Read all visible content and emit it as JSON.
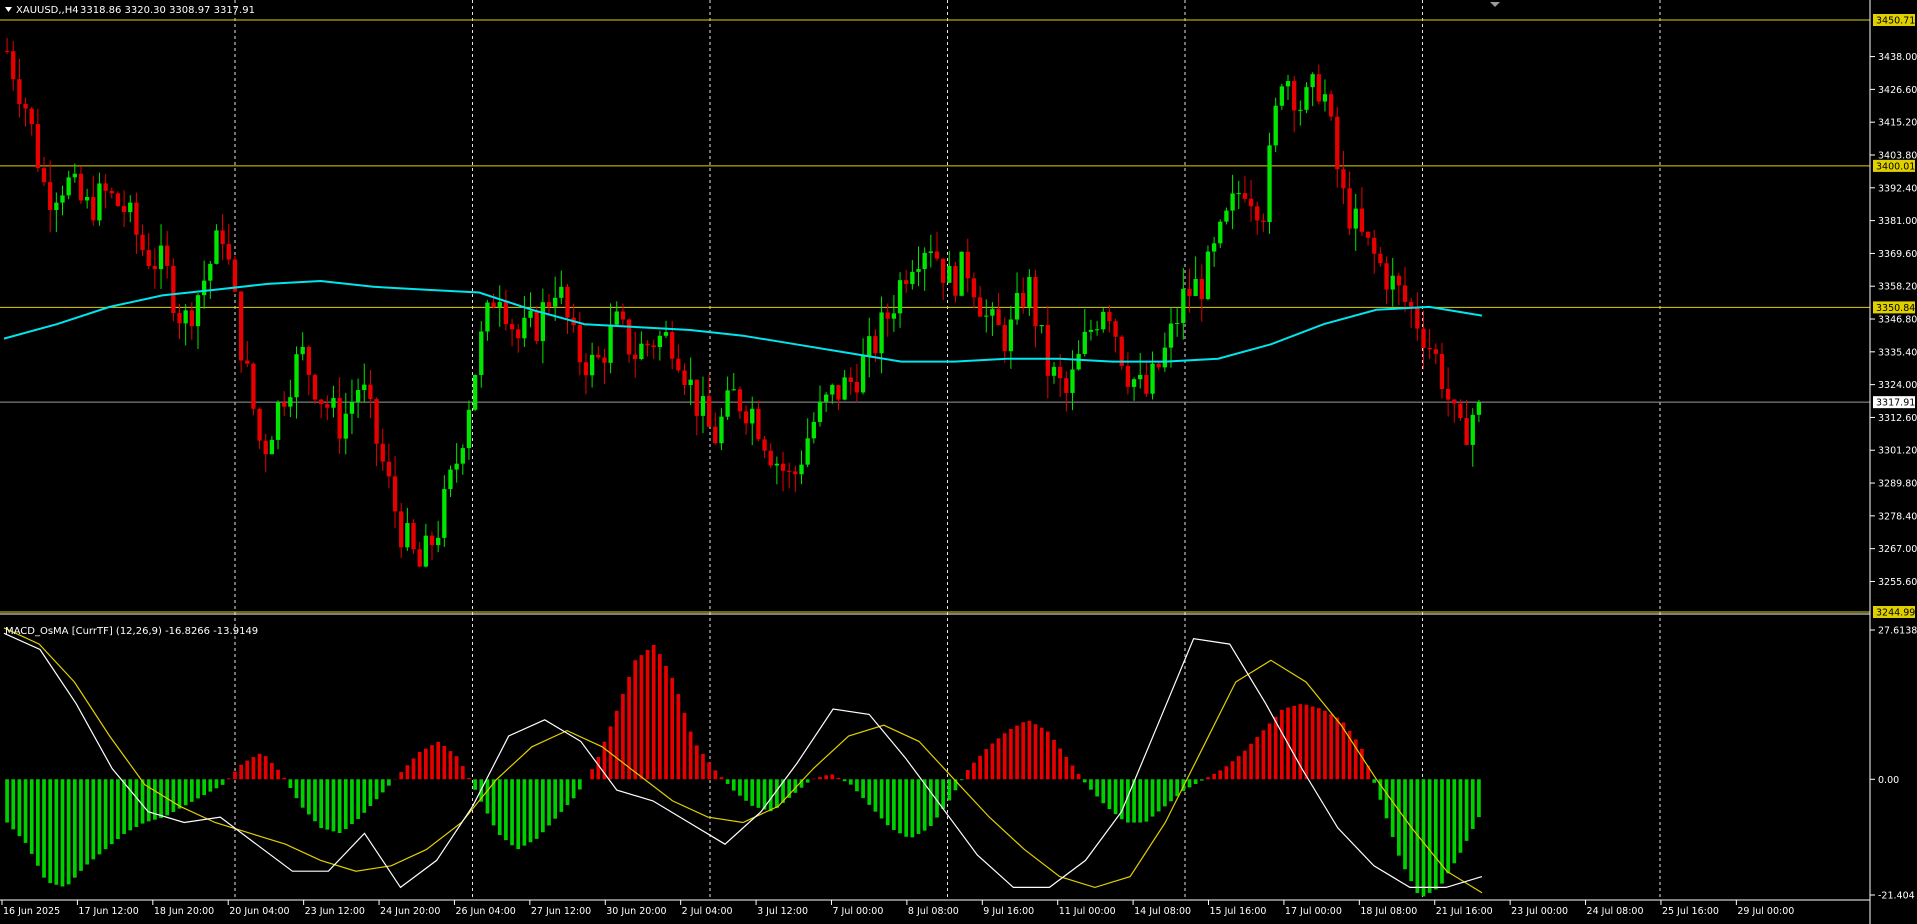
{
  "header": {
    "symbol_label": "XAUUSD,,H4",
    "ohlc_label": "3318.86 3320.30 3308.97 3317.91"
  },
  "indicator": {
    "label": "MACD_OsMA [CurrTF] (12,26,9) -16.8266 -13.9149"
  },
  "colors": {
    "background": "#000000",
    "bull_candle": "#00e600",
    "bear_candle": "#e60000",
    "moving_average": "#00e5ee",
    "hline": "#e0d000",
    "bid_line": "#9a9a9a",
    "macd_line": "#ffffff",
    "signal_line": "#e0d000",
    "osma_positive": "#e60000",
    "osma_negative": "#00d000",
    "grid": "#ffffff"
  },
  "chart_data": [
    {
      "type": "candlestick",
      "title": "",
      "ylim": [
        3244.99,
        3450.71
      ],
      "y_ticks": [
        "3438.00",
        "3426.60",
        "3415.20",
        "3403.80",
        "3392.40",
        "3381.00",
        "3369.60",
        "3358.20",
        "3346.80",
        "3335.40",
        "3324.00",
        "3312.60",
        "3301.20",
        "3289.80",
        "3278.40",
        "3267.00",
        "3255.60"
      ],
      "x_ticks": [
        "16 Jun 2025",
        "17 Jun 12:00",
        "18 Jun 20:00",
        "20 Jun 04:00",
        "23 Jun 12:00",
        "24 Jun 20:00",
        "26 Jun 04:00",
        "27 Jun 12:00",
        "30 Jun 20:00",
        "2 Jul 04:00",
        "3 Jul 12:00",
        "7 Jul 00:00",
        "8 Jul 08:00",
        "9 Jul 16:00",
        "11 Jul 00:00",
        "14 Jul 08:00",
        "15 Jul 16:00",
        "17 Jul 00:00",
        "18 Jul 08:00",
        "21 Jul 16:00",
        "23 Jul 00:00",
        "24 Jul 08:00",
        "25 Jul 16:00",
        "29 Jul 00:00"
      ],
      "horizontal_lines": [
        {
          "value": 3450.71,
          "label": "3450.71"
        },
        {
          "value": 3400.01,
          "label": "3400.01"
        },
        {
          "value": 3350.84,
          "label": "3350.84"
        },
        {
          "value": 3244.99,
          "label": "3244.99"
        }
      ],
      "bid": {
        "value": 3317.91,
        "label": "3317.91"
      },
      "path": [
        3440,
        3420,
        3390,
        3395,
        3385,
        3390,
        3385,
        3370,
        3365,
        3345,
        3360,
        3378,
        3335,
        3300,
        3320,
        3335,
        3320,
        3310,
        3325,
        3300,
        3275,
        3260,
        3275,
        3300,
        3335,
        3360,
        3340,
        3345,
        3360,
        3335,
        3330,
        3345,
        3335,
        3340,
        3340,
        3320,
        3305,
        3320,
        3315,
        3300,
        3290,
        3310,
        3320,
        3325,
        3335,
        3350,
        3368,
        3375,
        3360,
        3365,
        3345,
        3340,
        3360,
        3330,
        3320,
        3340,
        3355,
        3330,
        3320,
        3335,
        3355,
        3360,
        3378,
        3395,
        3385,
        3435,
        3420,
        3430,
        3390,
        3375,
        3365,
        3355,
        3345,
        3330,
        3305,
        3318
      ],
      "moving_average": [
        3340,
        3345,
        3351,
        3355,
        3357,
        3359,
        3360,
        3358,
        3357,
        3356,
        3350,
        3345,
        3344,
        3343,
        3341,
        3338,
        3335,
        3332,
        3332,
        3333,
        3333,
        3332,
        3332,
        3333,
        3338,
        3345,
        3350,
        3351,
        3348
      ]
    },
    {
      "type": "bar+line",
      "title": "",
      "ylim": [
        -21.404,
        27.6138
      ],
      "y_ticks": [
        "27.6138",
        "0.00",
        "-21.404"
      ],
      "osma": [
        -8,
        -12,
        -19,
        -20,
        -16,
        -13,
        -10,
        -8,
        -7,
        -5,
        -3,
        -1,
        3,
        5,
        1,
        -5,
        -9,
        -10,
        -7,
        -3,
        1,
        5,
        7,
        4,
        -3,
        -10,
        -13,
        -11,
        -7,
        -3,
        3,
        12,
        22,
        25,
        18,
        7,
        2,
        -2,
        -5,
        -6,
        -3,
        0,
        1,
        -1,
        -5,
        -9,
        -11,
        -9,
        -4,
        2,
        6,
        9,
        11,
        9,
        4,
        -1,
        -5,
        -8,
        -8,
        -5,
        -2,
        0,
        2,
        5,
        9,
        13,
        14,
        13,
        11,
        6,
        -4,
        -15,
        -22,
        -20,
        -14,
        -7
      ],
      "macd": [
        27,
        24,
        14,
        2,
        -6,
        -8,
        -7,
        -12,
        -17,
        -17,
        -10,
        -20,
        -15,
        -5,
        8,
        11,
        7,
        -2,
        -4,
        -8,
        -12,
        -6,
        3,
        13,
        12,
        4,
        -5,
        -14,
        -20,
        -20,
        -15,
        -6,
        10,
        26,
        25,
        14,
        2,
        -9,
        -16,
        -20,
        -20,
        -18
      ],
      "signal": [
        28,
        25,
        18,
        8,
        -1,
        -5,
        -8,
        -10,
        -12,
        -15,
        -17,
        -16,
        -13,
        -8,
        0,
        6,
        9,
        6,
        1,
        -4,
        -7,
        -8,
        -5,
        2,
        8,
        10,
        7,
        0,
        -7,
        -13,
        -18,
        -20,
        -18,
        -8,
        5,
        18,
        22,
        18,
        10,
        0,
        -9,
        -17,
        -21
      ]
    }
  ]
}
